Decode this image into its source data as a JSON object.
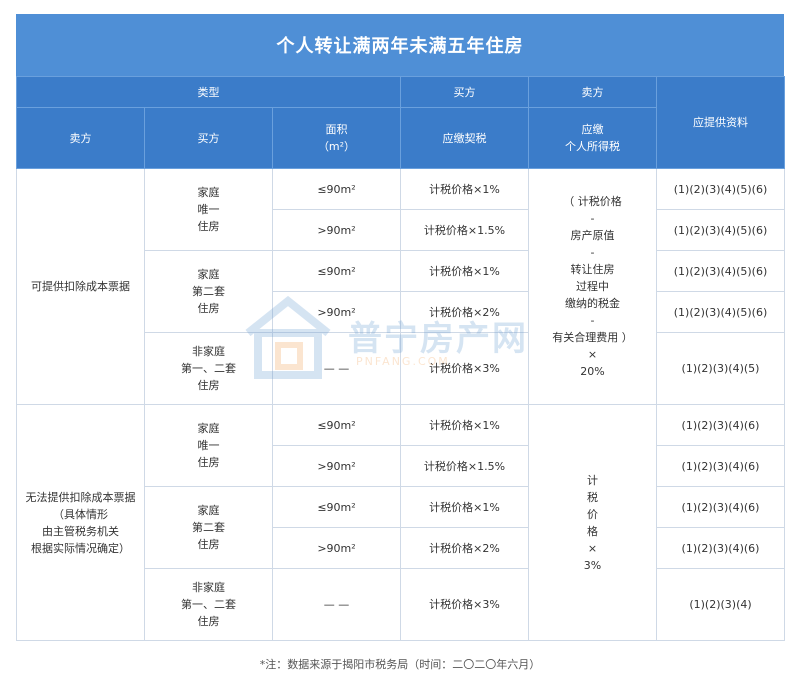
{
  "title": "个人转让满两年未满五年住房",
  "headers": {
    "type_group": "类型",
    "buyer_group": "买方",
    "seller_group": "卖方",
    "seller": "卖方",
    "buyer": "买方",
    "area": "面积\n（m²）",
    "deed_tax": "应缴契税",
    "income_tax": "应缴\n个人所得税",
    "docs": "应提供资料"
  },
  "sections": [
    {
      "seller": "可提供扣除成本票据",
      "income_tax": "（ 计税价格\n-\n房产原值\n-\n转让住房\n过程中\n缴纳的税金\n-\n有关合理费用 ）\n×\n20%",
      "groups": [
        {
          "buyer": "家庭\n唯一\n住房",
          "rows": [
            {
              "area": "≤90m²",
              "deed": "计税价格×1%",
              "docs": "(1)(2)(3)(4)(5)(6)"
            },
            {
              "area": ">90m²",
              "deed": "计税价格×1.5%",
              "docs": "(1)(2)(3)(4)(5)(6)"
            }
          ]
        },
        {
          "buyer": "家庭\n第二套\n住房",
          "rows": [
            {
              "area": "≤90m²",
              "deed": "计税价格×1%",
              "docs": "(1)(2)(3)(4)(5)(6)"
            },
            {
              "area": ">90m²",
              "deed": "计税价格×2%",
              "docs": "(1)(2)(3)(4)(5)(6)"
            }
          ]
        },
        {
          "buyer": "非家庭\n第一、二套\n住房",
          "rows": [
            {
              "area": "— —",
              "deed": "计税价格×3%",
              "docs": "(1)(2)(3)(4)(5)"
            }
          ]
        }
      ]
    },
    {
      "seller": "无法提供扣除成本票据\n（具体情形\n由主管税务机关\n根据实际情况确定）",
      "income_tax": "计\n税\n价\n格\n×\n3%",
      "groups": [
        {
          "buyer": "家庭\n唯一\n住房",
          "rows": [
            {
              "area": "≤90m²",
              "deed": "计税价格×1%",
              "docs": "(1)(2)(3)(4)(6)"
            },
            {
              "area": ">90m²",
              "deed": "计税价格×1.5%",
              "docs": "(1)(2)(3)(4)(6)"
            }
          ]
        },
        {
          "buyer": "家庭\n第二套\n住房",
          "rows": [
            {
              "area": "≤90m²",
              "deed": "计税价格×1%",
              "docs": "(1)(2)(3)(4)(6)"
            },
            {
              "area": ">90m²",
              "deed": "计税价格×2%",
              "docs": "(1)(2)(3)(4)(6)"
            }
          ]
        },
        {
          "buyer": "非家庭\n第一、二套\n住房",
          "rows": [
            {
              "area": "— —",
              "deed": "计税价格×3%",
              "docs": "(1)(2)(3)(4)"
            }
          ]
        }
      ]
    }
  ],
  "watermark": {
    "text": "普宁房产网",
    "sub": "PNFANG.COM",
    "icon": "house-logo-icon"
  },
  "footnote": "*注：数据来源于揭阳市税务局（时间：二〇二〇年六月）"
}
